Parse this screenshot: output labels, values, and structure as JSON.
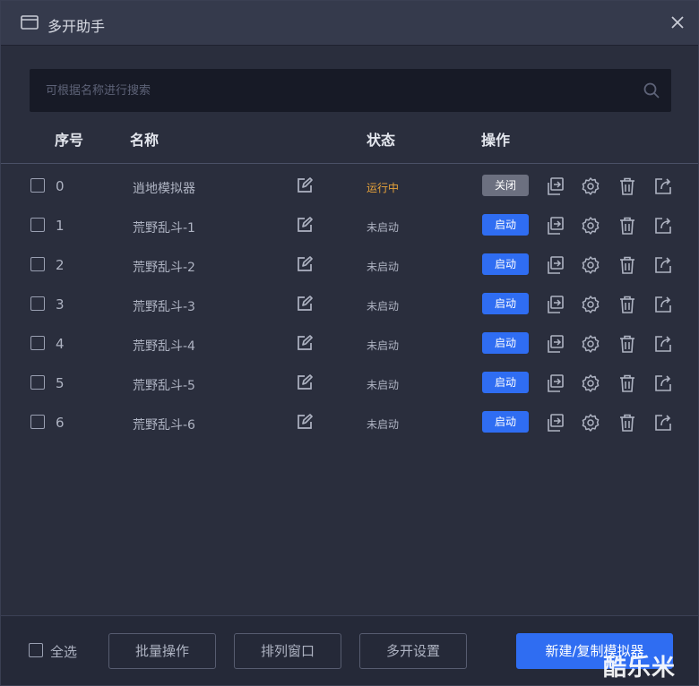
{
  "window": {
    "title": "多开助手"
  },
  "search": {
    "placeholder": "可根据名称进行搜索"
  },
  "table": {
    "headers": {
      "index": "序号",
      "name": "名称",
      "status": "状态",
      "actions": "操作"
    },
    "rows": [
      {
        "index": "0",
        "name": "逍地模拟器",
        "status": "运行中",
        "running": true,
        "action": "关闭"
      },
      {
        "index": "1",
        "name": "荒野乱斗-1",
        "status": "未启动",
        "running": false,
        "action": "启动"
      },
      {
        "index": "2",
        "name": "荒野乱斗-2",
        "status": "未启动",
        "running": false,
        "action": "启动"
      },
      {
        "index": "3",
        "name": "荒野乱斗-3",
        "status": "未启动",
        "running": false,
        "action": "启动"
      },
      {
        "index": "4",
        "name": "荒野乱斗-4",
        "status": "未启动",
        "running": false,
        "action": "启动"
      },
      {
        "index": "5",
        "name": "荒野乱斗-5",
        "status": "未启动",
        "running": false,
        "action": "启动"
      },
      {
        "index": "6",
        "name": "荒野乱斗-6",
        "status": "未启动",
        "running": false,
        "action": "启动"
      }
    ]
  },
  "footer": {
    "select_all": "全选",
    "batch": "批量操作",
    "arrange": "排列窗口",
    "settings": "多开设置",
    "new": "新建/复制模拟器"
  },
  "watermark": "酷乐米",
  "colors": {
    "accent": "#2f6df2",
    "running": "#e8a33a",
    "stop_button": "#6c7080"
  },
  "icons": [
    "window-icon",
    "close-icon",
    "search-icon",
    "edit-icon",
    "copy-icon",
    "gear-icon",
    "trash-icon",
    "export-icon"
  ]
}
